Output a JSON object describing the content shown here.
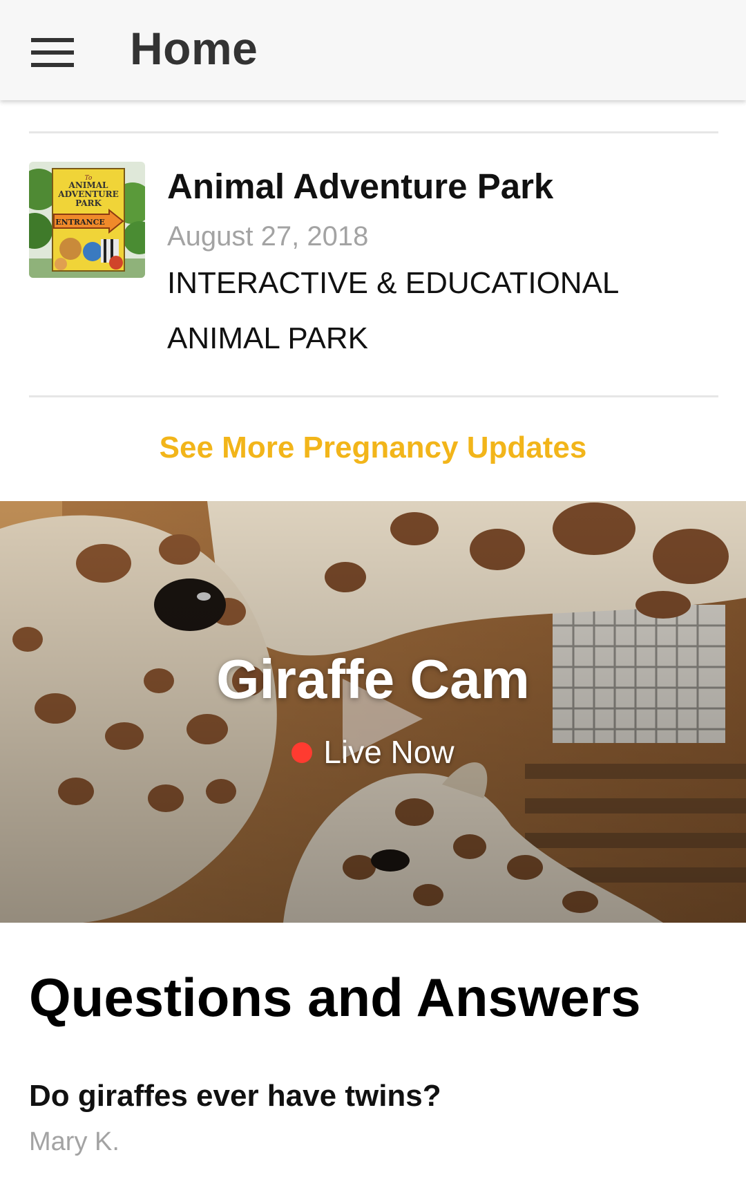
{
  "app_bar": {
    "menu_icon": "hamburger-menu-icon",
    "title": "Home"
  },
  "article": {
    "title": "Animal Adventure Park",
    "date": "August 27, 2018",
    "description": "INTERACTIVE & EDUCATIONAL ANIMAL PARK",
    "thumbnail": {
      "sign_line1": "To",
      "sign_line2": "ANIMAL",
      "sign_line3": "ADVENTURE",
      "sign_line4": "PARK",
      "sign_line5": "ENTRANCE"
    }
  },
  "see_more_label": "See More Pregnancy Updates",
  "live_cam": {
    "title": "Giraffe Cam",
    "status": "Live Now",
    "play_icon": "play-icon"
  },
  "qa": {
    "heading": "Questions and Answers",
    "items": [
      {
        "question": "Do giraffes ever have twins?",
        "author": "Mary K."
      }
    ]
  },
  "colors": {
    "accent": "#f2b51a",
    "live_dot": "#ff3b30",
    "app_bar_bg": "#f7f7f7",
    "muted_text": "#a3a3a3"
  }
}
